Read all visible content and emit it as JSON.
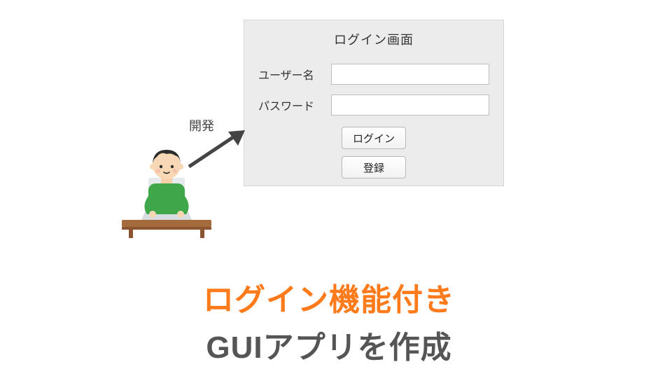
{
  "window": {
    "title": "ログイン画面",
    "fields": {
      "username_label": "ユーザー名",
      "password_label": "パスワード",
      "username_value": "",
      "password_value": ""
    },
    "buttons": {
      "login": "ログイン",
      "register": "登録"
    }
  },
  "arrow_label": "開発",
  "headline": {
    "line1": "ログイン機能付き",
    "line2": "GUIアプリを作成"
  },
  "colors": {
    "accent_orange": "#ff7a1a",
    "text_gray": "#555555",
    "panel_bg": "#ececec"
  },
  "illustration": {
    "description": "person-at-laptop"
  }
}
